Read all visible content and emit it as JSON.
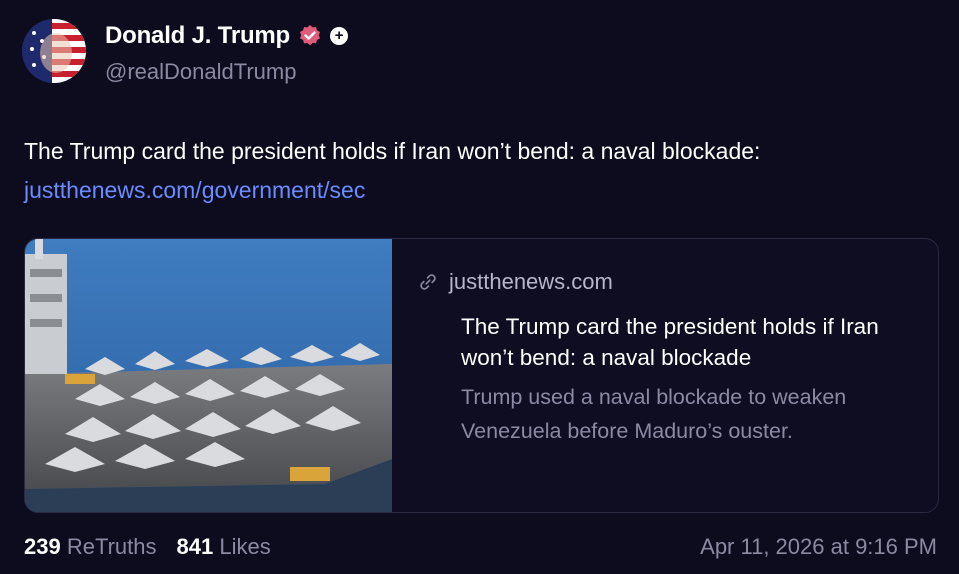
{
  "author": {
    "display_name": "Donald J. Trump",
    "handle": "@realDonaldTrump",
    "badge_icon": "verified-badge-icon",
    "plus_icon": "plus-icon",
    "plus_label": "+"
  },
  "post": {
    "text": "The Trump card the president holds if Iran won’t bend: a naval blockade:",
    "link_text": "justthenews.com/government/sec"
  },
  "card": {
    "domain": "justthenews.com",
    "title": "The Trump card the president holds if Iran won’t bend: a naval blockade",
    "description": "Trump used a naval blockade to weaken Venezuela before Maduro’s ouster.",
    "image_icon": "aircraft-carrier-photo"
  },
  "stats": {
    "retruths_count": "239",
    "retruths_label": "ReTruths",
    "likes_count": "841",
    "likes_label": "Likes"
  },
  "timestamp": "Apr 11, 2026 at 9:16 PM",
  "colors": {
    "background": "#0d0b1e",
    "link": "#6a8cff",
    "muted": "#8c8aa3",
    "verified": "#e05a7a"
  }
}
